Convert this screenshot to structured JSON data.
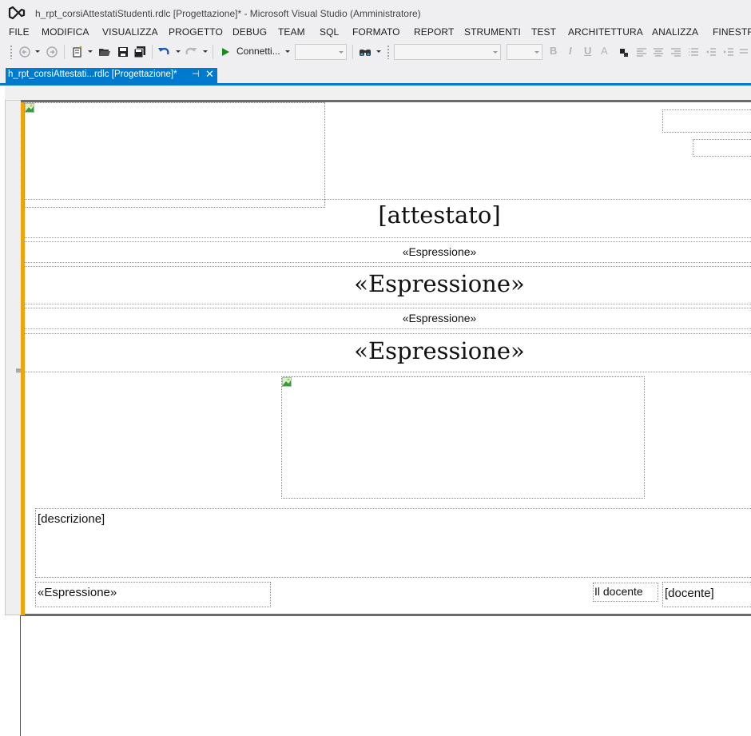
{
  "window": {
    "title": "h_rpt_corsiAttestatiStudenti.rdlc [Progettazione]* - Microsoft Visual Studio (Amministratore)"
  },
  "menu": [
    "FILE",
    "MODIFICA",
    "VISUALIZZA",
    "PROGETTO",
    "DEBUG",
    "TEAM",
    "SQL",
    "FORMATO",
    "REPORT",
    "STRUMENTI",
    "TEST",
    "ARCHITETTURA",
    "ANALIZZA",
    "FINESTRA"
  ],
  "toolbar": {
    "run_label": "Connetti...",
    "bold": "B",
    "italic": "I",
    "underline": "U",
    "font_color": "A"
  },
  "tab": {
    "label": "h_rpt_corsiAttestati...rdlc [Progettazione]*",
    "pin": "⊣",
    "close": "✕"
  },
  "report": {
    "attestato": "[attestato]",
    "expr_small_1": "«Espressione»",
    "expr_big_1": "«Espressione»",
    "expr_small_2": "«Espressione»",
    "expr_big_2": "«Espressione»",
    "descrizione": "[descrizione]",
    "footer_expr": "«Espressione»",
    "docente_label": "Il docente",
    "docente_value": "[docente]"
  },
  "colors": {
    "accent": "#007acc",
    "selection": "#f0a30a",
    "chrome": "#efeff2"
  }
}
